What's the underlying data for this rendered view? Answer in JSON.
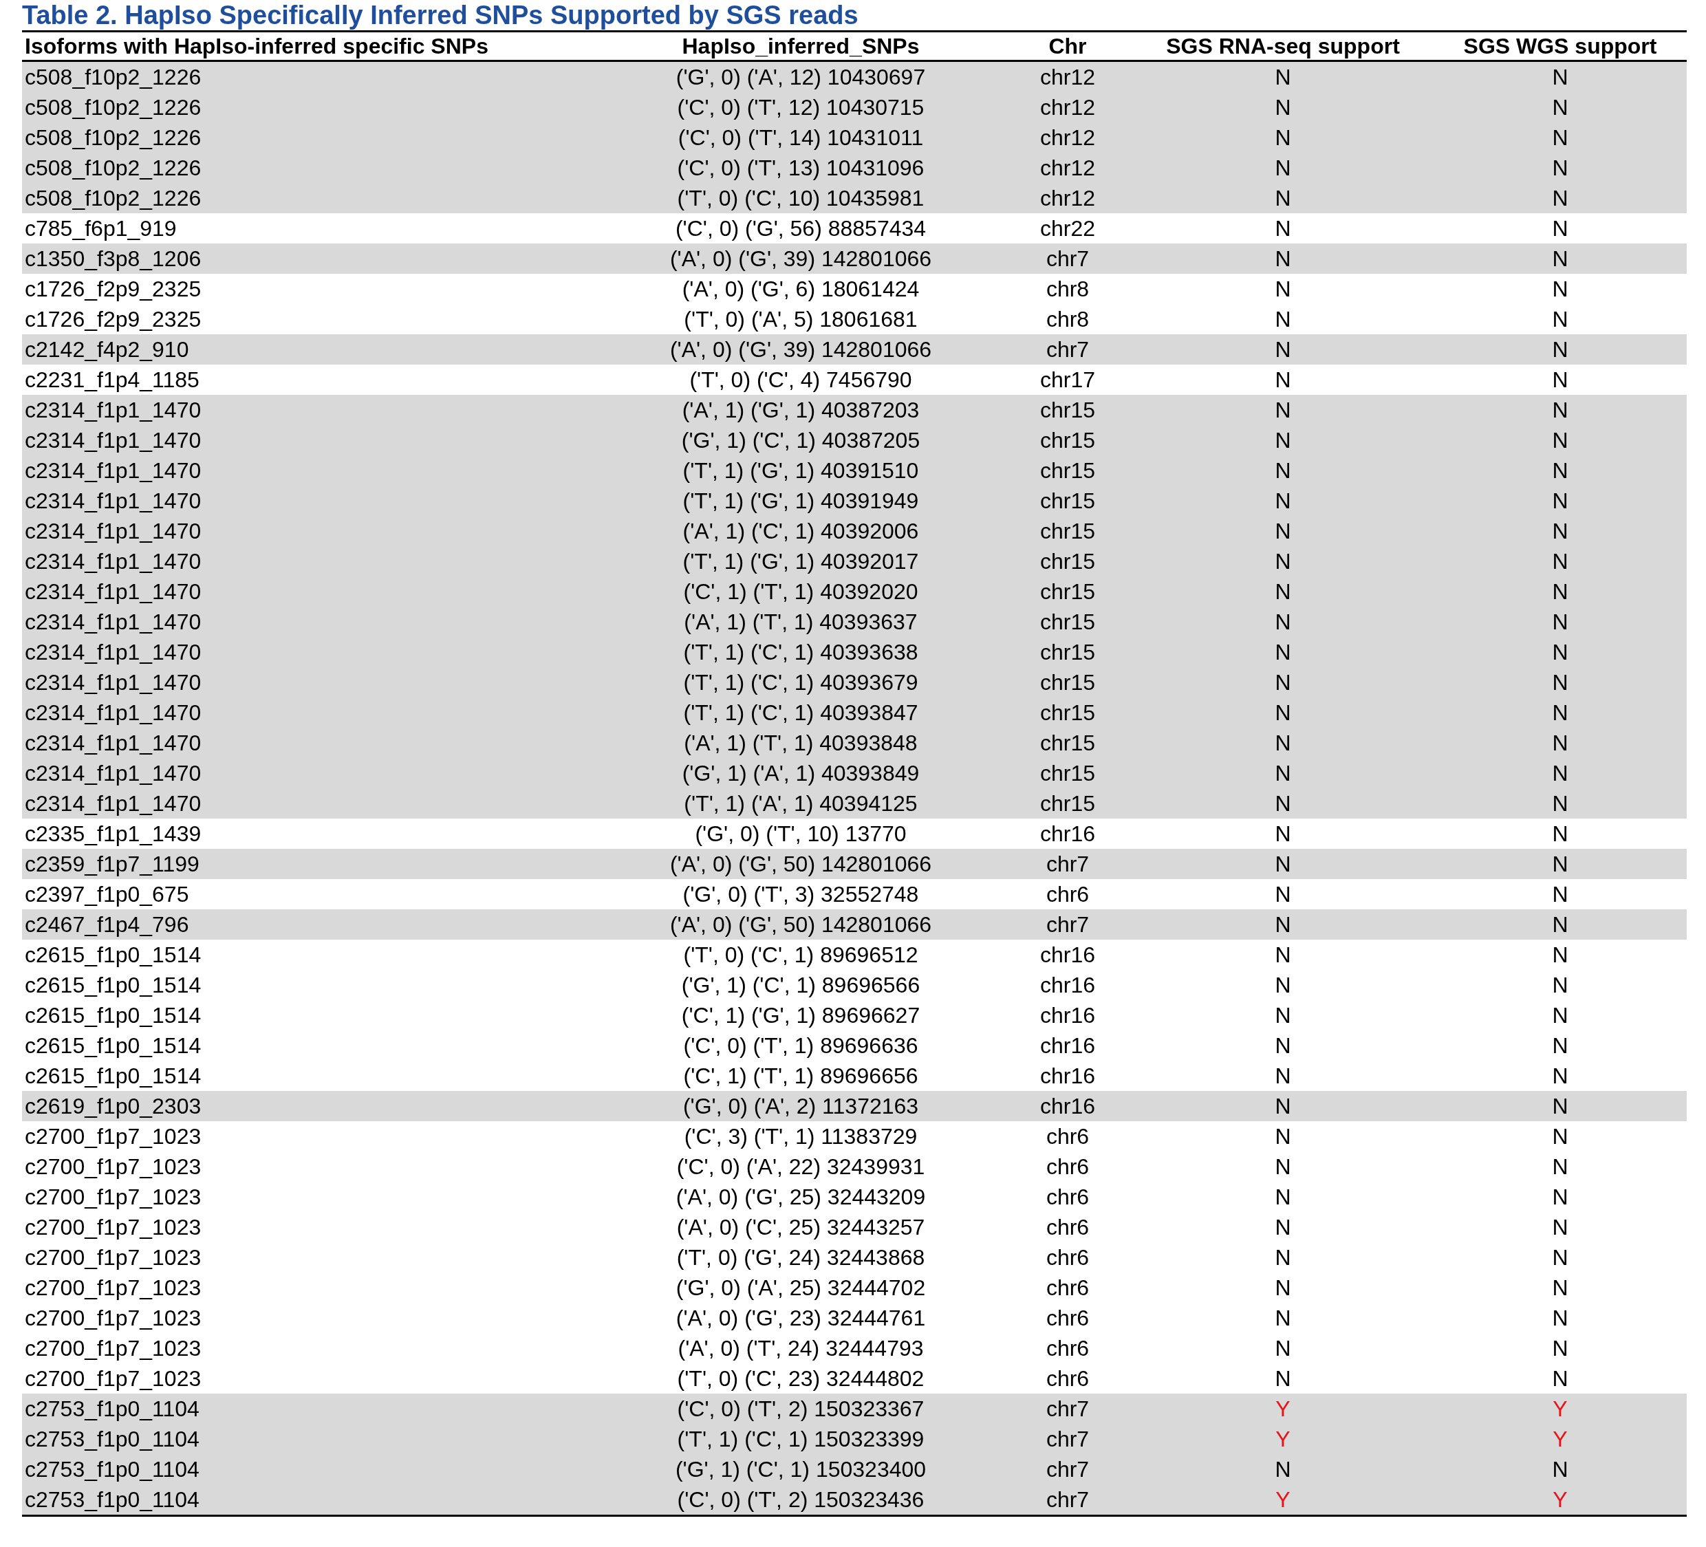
{
  "title": "Table 2. HapIso Specifically Inferred SNPs Supported by SGS reads",
  "columns": [
    "Isoforms with HapIso-inferred specific SNPs",
    "HapIso_inferred_SNPs",
    "Chr",
    "SGS RNA-seq support",
    "SGS WGS support"
  ],
  "rows": [
    {
      "isoform": "c508_f10p2_1226",
      "snps": "('G', 0) ('A', 12) 10430697",
      "chr": "chr12",
      "rna": "N",
      "wgs": "N",
      "rna_yes": false,
      "wgs_yes": false,
      "shaded": true
    },
    {
      "isoform": "c508_f10p2_1226",
      "snps": "('C', 0) ('T', 12) 10430715",
      "chr": "chr12",
      "rna": "N",
      "wgs": "N",
      "rna_yes": false,
      "wgs_yes": false,
      "shaded": true
    },
    {
      "isoform": "c508_f10p2_1226",
      "snps": "('C', 0) ('T', 14) 10431011",
      "chr": "chr12",
      "rna": "N",
      "wgs": "N",
      "rna_yes": false,
      "wgs_yes": false,
      "shaded": true
    },
    {
      "isoform": "c508_f10p2_1226",
      "snps": "('C', 0) ('T', 13) 10431096",
      "chr": "chr12",
      "rna": "N",
      "wgs": "N",
      "rna_yes": false,
      "wgs_yes": false,
      "shaded": true
    },
    {
      "isoform": "c508_f10p2_1226",
      "snps": "('T', 0) ('C', 10) 10435981",
      "chr": "chr12",
      "rna": "N",
      "wgs": "N",
      "rna_yes": false,
      "wgs_yes": false,
      "shaded": true
    },
    {
      "isoform": "c785_f6p1_919",
      "snps": "('C', 0) ('G', 56) 88857434",
      "chr": "chr22",
      "rna": "N",
      "wgs": "N",
      "rna_yes": false,
      "wgs_yes": false,
      "shaded": false
    },
    {
      "isoform": "c1350_f3p8_1206",
      "snps": "('A', 0) ('G', 39) 142801066",
      "chr": "chr7",
      "rna": "N",
      "wgs": "N",
      "rna_yes": false,
      "wgs_yes": false,
      "shaded": true
    },
    {
      "isoform": "c1726_f2p9_2325",
      "snps": "('A', 0) ('G', 6) 18061424",
      "chr": "chr8",
      "rna": "N",
      "wgs": "N",
      "rna_yes": false,
      "wgs_yes": false,
      "shaded": false
    },
    {
      "isoform": "c1726_f2p9_2325",
      "snps": "('T', 0) ('A', 5) 18061681",
      "chr": "chr8",
      "rna": "N",
      "wgs": "N",
      "rna_yes": false,
      "wgs_yes": false,
      "shaded": false
    },
    {
      "isoform": "c2142_f4p2_910",
      "snps": "('A', 0) ('G', 39) 142801066",
      "chr": "chr7",
      "rna": "N",
      "wgs": "N",
      "rna_yes": false,
      "wgs_yes": false,
      "shaded": true
    },
    {
      "isoform": "c2231_f1p4_1185",
      "snps": "('T', 0) ('C', 4) 7456790",
      "chr": "chr17",
      "rna": "N",
      "wgs": "N",
      "rna_yes": false,
      "wgs_yes": false,
      "shaded": false
    },
    {
      "isoform": "c2314_f1p1_1470",
      "snps": "('A', 1) ('G', 1) 40387203",
      "chr": "chr15",
      "rna": "N",
      "wgs": "N",
      "rna_yes": false,
      "wgs_yes": false,
      "shaded": true
    },
    {
      "isoform": "c2314_f1p1_1470",
      "snps": "('G', 1) ('C', 1) 40387205",
      "chr": "chr15",
      "rna": "N",
      "wgs": "N",
      "rna_yes": false,
      "wgs_yes": false,
      "shaded": true
    },
    {
      "isoform": "c2314_f1p1_1470",
      "snps": "('T', 1) ('G', 1) 40391510",
      "chr": "chr15",
      "rna": "N",
      "wgs": "N",
      "rna_yes": false,
      "wgs_yes": false,
      "shaded": true
    },
    {
      "isoform": "c2314_f1p1_1470",
      "snps": "('T', 1) ('G', 1) 40391949",
      "chr": "chr15",
      "rna": "N",
      "wgs": "N",
      "rna_yes": false,
      "wgs_yes": false,
      "shaded": true
    },
    {
      "isoform": "c2314_f1p1_1470",
      "snps": "('A', 1) ('C', 1) 40392006",
      "chr": "chr15",
      "rna": "N",
      "wgs": "N",
      "rna_yes": false,
      "wgs_yes": false,
      "shaded": true
    },
    {
      "isoform": "c2314_f1p1_1470",
      "snps": "('T', 1) ('G', 1) 40392017",
      "chr": "chr15",
      "rna": "N",
      "wgs": "N",
      "rna_yes": false,
      "wgs_yes": false,
      "shaded": true
    },
    {
      "isoform": "c2314_f1p1_1470",
      "snps": "('C', 1) ('T', 1) 40392020",
      "chr": "chr15",
      "rna": "N",
      "wgs": "N",
      "rna_yes": false,
      "wgs_yes": false,
      "shaded": true
    },
    {
      "isoform": "c2314_f1p1_1470",
      "snps": "('A', 1) ('T', 1) 40393637",
      "chr": "chr15",
      "rna": "N",
      "wgs": "N",
      "rna_yes": false,
      "wgs_yes": false,
      "shaded": true
    },
    {
      "isoform": "c2314_f1p1_1470",
      "snps": "('T', 1) ('C', 1) 40393638",
      "chr": "chr15",
      "rna": "N",
      "wgs": "N",
      "rna_yes": false,
      "wgs_yes": false,
      "shaded": true
    },
    {
      "isoform": "c2314_f1p1_1470",
      "snps": "('T', 1) ('C', 1) 40393679",
      "chr": "chr15",
      "rna": "N",
      "wgs": "N",
      "rna_yes": false,
      "wgs_yes": false,
      "shaded": true
    },
    {
      "isoform": "c2314_f1p1_1470",
      "snps": "('T', 1) ('C', 1) 40393847",
      "chr": "chr15",
      "rna": "N",
      "wgs": "N",
      "rna_yes": false,
      "wgs_yes": false,
      "shaded": true
    },
    {
      "isoform": "c2314_f1p1_1470",
      "snps": "('A', 1) ('T', 1) 40393848",
      "chr": "chr15",
      "rna": "N",
      "wgs": "N",
      "rna_yes": false,
      "wgs_yes": false,
      "shaded": true
    },
    {
      "isoform": "c2314_f1p1_1470",
      "snps": "('G', 1) ('A', 1) 40393849",
      "chr": "chr15",
      "rna": "N",
      "wgs": "N",
      "rna_yes": false,
      "wgs_yes": false,
      "shaded": true
    },
    {
      "isoform": "c2314_f1p1_1470",
      "snps": "('T', 1) ('A', 1) 40394125",
      "chr": "chr15",
      "rna": "N",
      "wgs": "N",
      "rna_yes": false,
      "wgs_yes": false,
      "shaded": true
    },
    {
      "isoform": "c2335_f1p1_1439",
      "snps": "('G', 0) ('T', 10) 13770",
      "chr": "chr16",
      "rna": "N",
      "wgs": "N",
      "rna_yes": false,
      "wgs_yes": false,
      "shaded": false
    },
    {
      "isoform": "c2359_f1p7_1199",
      "snps": "('A', 0) ('G', 50) 142801066",
      "chr": "chr7",
      "rna": "N",
      "wgs": "N",
      "rna_yes": false,
      "wgs_yes": false,
      "shaded": true
    },
    {
      "isoform": "c2397_f1p0_675",
      "snps": "('G', 0) ('T', 3) 32552748",
      "chr": "chr6",
      "rna": "N",
      "wgs": "N",
      "rna_yes": false,
      "wgs_yes": false,
      "shaded": false
    },
    {
      "isoform": "c2467_f1p4_796",
      "snps": "('A', 0) ('G', 50) 142801066",
      "chr": "chr7",
      "rna": "N",
      "wgs": "N",
      "rna_yes": false,
      "wgs_yes": false,
      "shaded": true
    },
    {
      "isoform": "c2615_f1p0_1514",
      "snps": "('T', 0) ('C', 1) 89696512",
      "chr": "chr16",
      "rna": "N",
      "wgs": "N",
      "rna_yes": false,
      "wgs_yes": false,
      "shaded": false
    },
    {
      "isoform": "c2615_f1p0_1514",
      "snps": "('G', 1) ('C', 1) 89696566",
      "chr": "chr16",
      "rna": "N",
      "wgs": "N",
      "rna_yes": false,
      "wgs_yes": false,
      "shaded": false
    },
    {
      "isoform": "c2615_f1p0_1514",
      "snps": "('C', 1) ('G', 1) 89696627",
      "chr": "chr16",
      "rna": "N",
      "wgs": "N",
      "rna_yes": false,
      "wgs_yes": false,
      "shaded": false
    },
    {
      "isoform": "c2615_f1p0_1514",
      "snps": "('C', 0) ('T', 1) 89696636",
      "chr": "chr16",
      "rna": "N",
      "wgs": "N",
      "rna_yes": false,
      "wgs_yes": false,
      "shaded": false
    },
    {
      "isoform": "c2615_f1p0_1514",
      "snps": "('C', 1) ('T', 1) 89696656",
      "chr": "chr16",
      "rna": "N",
      "wgs": "N",
      "rna_yes": false,
      "wgs_yes": false,
      "shaded": false
    },
    {
      "isoform": "c2619_f1p0_2303",
      "snps": "('G', 0) ('A', 2) 11372163",
      "chr": "chr16",
      "rna": "N",
      "wgs": "N",
      "rna_yes": false,
      "wgs_yes": false,
      "shaded": true
    },
    {
      "isoform": "c2700_f1p7_1023",
      "snps": "('C', 3) ('T', 1) 11383729",
      "chr": "chr6",
      "rna": "N",
      "wgs": "N",
      "rna_yes": false,
      "wgs_yes": false,
      "shaded": false
    },
    {
      "isoform": "c2700_f1p7_1023",
      "snps": "('C', 0) ('A', 22) 32439931",
      "chr": "chr6",
      "rna": "N",
      "wgs": "N",
      "rna_yes": false,
      "wgs_yes": false,
      "shaded": false
    },
    {
      "isoform": "c2700_f1p7_1023",
      "snps": "('A', 0) ('G', 25) 32443209",
      "chr": "chr6",
      "rna": "N",
      "wgs": "N",
      "rna_yes": false,
      "wgs_yes": false,
      "shaded": false
    },
    {
      "isoform": "c2700_f1p7_1023",
      "snps": "('A', 0) ('C', 25) 32443257",
      "chr": "chr6",
      "rna": "N",
      "wgs": "N",
      "rna_yes": false,
      "wgs_yes": false,
      "shaded": false
    },
    {
      "isoform": "c2700_f1p7_1023",
      "snps": "('T', 0) ('G', 24) 32443868",
      "chr": "chr6",
      "rna": "N",
      "wgs": "N",
      "rna_yes": false,
      "wgs_yes": false,
      "shaded": false
    },
    {
      "isoform": "c2700_f1p7_1023",
      "snps": "('G', 0) ('A', 25) 32444702",
      "chr": "chr6",
      "rna": "N",
      "wgs": "N",
      "rna_yes": false,
      "wgs_yes": false,
      "shaded": false
    },
    {
      "isoform": "c2700_f1p7_1023",
      "snps": "('A', 0) ('G', 23) 32444761",
      "chr": "chr6",
      "rna": "N",
      "wgs": "N",
      "rna_yes": false,
      "wgs_yes": false,
      "shaded": false
    },
    {
      "isoform": "c2700_f1p7_1023",
      "snps": "('A', 0) ('T', 24) 32444793",
      "chr": "chr6",
      "rna": "N",
      "wgs": "N",
      "rna_yes": false,
      "wgs_yes": false,
      "shaded": false
    },
    {
      "isoform": "c2700_f1p7_1023",
      "snps": "('T', 0) ('C', 23) 32444802",
      "chr": "chr6",
      "rna": "N",
      "wgs": "N",
      "rna_yes": false,
      "wgs_yes": false,
      "shaded": false
    },
    {
      "isoform": "c2753_f1p0_1104",
      "snps": "('C', 0) ('T', 2) 150323367",
      "chr": "chr7",
      "rna": "Y",
      "wgs": "Y",
      "rna_yes": true,
      "wgs_yes": true,
      "shaded": true
    },
    {
      "isoform": "c2753_f1p0_1104",
      "snps": "('T', 1) ('C', 1) 150323399",
      "chr": "chr7",
      "rna": "Y",
      "wgs": "Y",
      "rna_yes": true,
      "wgs_yes": true,
      "shaded": true
    },
    {
      "isoform": "c2753_f1p0_1104",
      "snps": "('G', 1) ('C', 1) 150323400",
      "chr": "chr7",
      "rna": "N",
      "wgs": "N",
      "rna_yes": false,
      "wgs_yes": false,
      "shaded": true
    },
    {
      "isoform": "c2753_f1p0_1104",
      "snps": "('C', 0) ('T', 2) 150323436",
      "chr": "chr7",
      "rna": "Y",
      "wgs": "Y",
      "rna_yes": true,
      "wgs_yes": true,
      "shaded": true
    }
  ]
}
